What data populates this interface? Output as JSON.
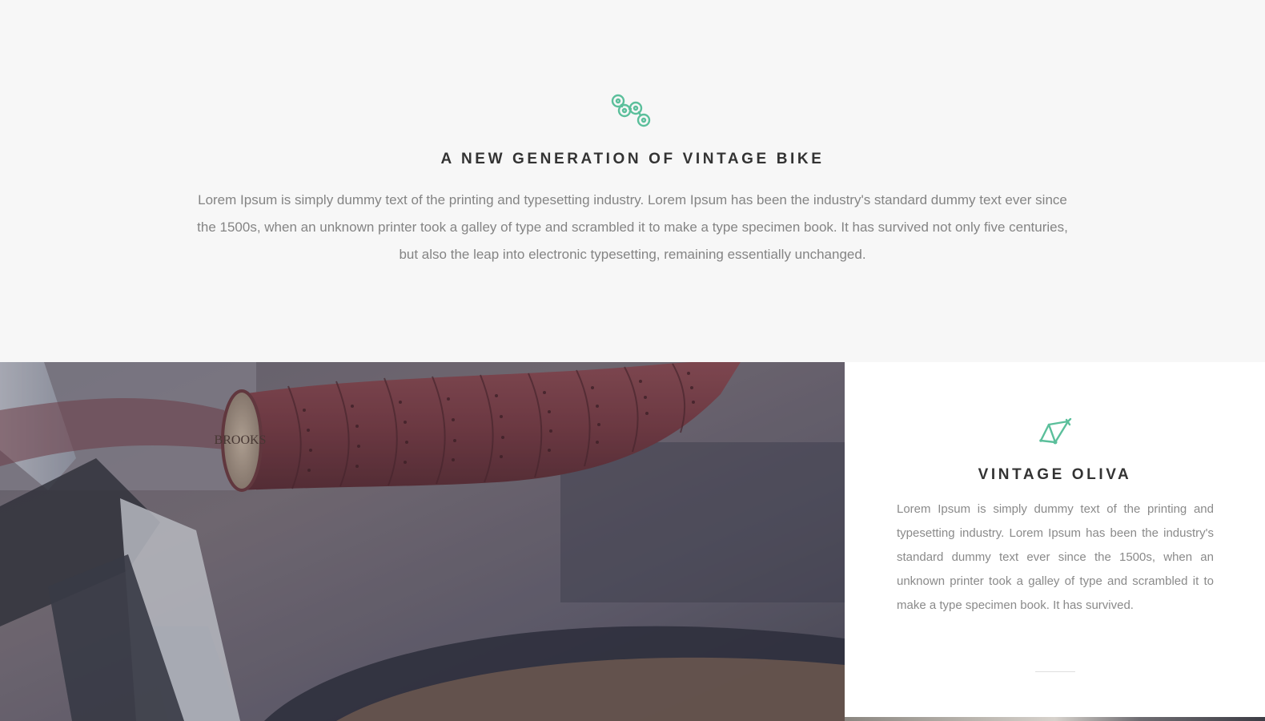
{
  "intro": {
    "icon": "bike-chain-icon",
    "title": "A NEW GENERATION OF VINTAGE BIKE",
    "text": "Lorem Ipsum is simply dummy text of the printing and typesetting industry. Lorem Ipsum has been the industry's standard dummy text ever since the 1500s, when an unknown printer took a galley of type and scrambled it to make a type specimen book. It has survived not only five centuries, but also the leap into electronic typesetting, remaining essentially unchanged."
  },
  "feature": {
    "image": {
      "subject": "bicycle-handlebar-photo",
      "end_cap_text": "BROOKS"
    },
    "card": {
      "icon": "bike-frame-icon",
      "title": "VINTAGE OLIVA",
      "text": "Lorem Ipsum is simply dummy text of the printing and typesetting industry. Lorem Ipsum has been the industry's standard dummy text ever since the 1500s, when an unknown printer took a galley of type and scrambled it to make a type specimen book. It has survived."
    }
  },
  "colors": {
    "accent": "#5bbf9b",
    "background": "#f7f7f7",
    "heading": "#333333",
    "body_text": "#848484"
  }
}
